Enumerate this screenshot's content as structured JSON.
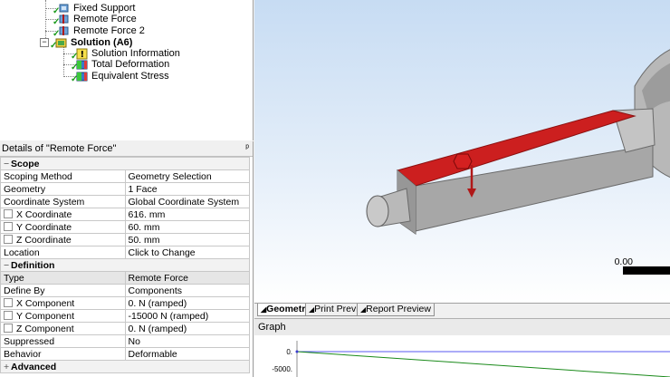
{
  "tree": {
    "items": [
      {
        "label": "Fixed Support"
      },
      {
        "label": "Remote Force"
      },
      {
        "label": "Remote Force 2"
      },
      {
        "label": "Solution (A6)"
      },
      {
        "label": "Solution Information"
      },
      {
        "label": "Total Deformation"
      },
      {
        "label": "Equivalent Stress"
      }
    ]
  },
  "details": {
    "title": "Details of \"Remote Force\"",
    "scope": {
      "header": "Scope",
      "rows": [
        {
          "label": "Scoping Method",
          "value": "Geometry Selection"
        },
        {
          "label": "Geometry",
          "value": "1 Face"
        },
        {
          "label": "Coordinate System",
          "value": "Global Coordinate System"
        },
        {
          "label": "X Coordinate",
          "value": "616. mm"
        },
        {
          "label": "Y Coordinate",
          "value": "60. mm"
        },
        {
          "label": "Z Coordinate",
          "value": "50. mm"
        },
        {
          "label": "Location",
          "value": "Click to Change"
        }
      ]
    },
    "definition": {
      "header": "Definition",
      "rows": [
        {
          "label": "Type",
          "value": "Remote Force"
        },
        {
          "label": "Define By",
          "value": "Components"
        },
        {
          "label": "X Component",
          "value": "0. N  (ramped)"
        },
        {
          "label": "Y Component",
          "value": "-15000 N  (ramped)"
        },
        {
          "label": "Z Component",
          "value": "0. N  (ramped)"
        },
        {
          "label": "Suppressed",
          "value": "No"
        },
        {
          "label": "Behavior",
          "value": "Deformable"
        }
      ]
    },
    "advanced": {
      "header": "Advanced"
    }
  },
  "viewport": {
    "scale_value": "0.00",
    "colors": {
      "selected_face": "#cc1f1f",
      "body": "#b4b4b4",
      "force_arrow": "#b01818"
    }
  },
  "tabs": [
    {
      "label": "Geometry"
    },
    {
      "label": "Print Preview"
    },
    {
      "label": "Report Preview"
    }
  ],
  "graph": {
    "title": "Graph",
    "y_ticks": [
      "0.",
      "-5000."
    ]
  }
}
